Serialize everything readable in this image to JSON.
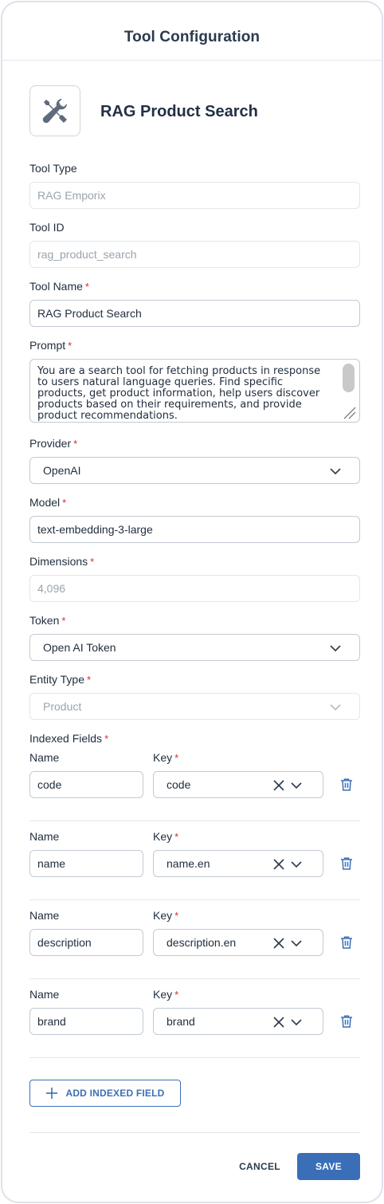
{
  "dialog": {
    "title": "Tool Configuration"
  },
  "tool": {
    "icon": "tools-icon",
    "display_name": "RAG Product Search"
  },
  "fields": {
    "tool_type": {
      "label": "Tool Type",
      "value": "RAG Emporix"
    },
    "tool_id": {
      "label": "Tool ID",
      "value": "rag_product_search"
    },
    "tool_name": {
      "label": "Tool Name",
      "required_mark": "*",
      "value": "RAG Product Search"
    },
    "prompt": {
      "label": "Prompt",
      "required_mark": "*",
      "lines": [
        "You are a search tool for fetching products in response",
        "to users natural language queries. Find specific",
        "products, get product information, help users discover",
        "products based on their requirements, and provide",
        "product recommendations."
      ]
    },
    "provider": {
      "label": "Provider",
      "required_mark": "*",
      "value": "OpenAI"
    },
    "model": {
      "label": "Model",
      "required_mark": "*",
      "value": "text-embedding-3-large"
    },
    "dimensions": {
      "label": "Dimensions",
      "required_mark": "*",
      "value": "4,096"
    },
    "token": {
      "label": "Token",
      "required_mark": "*",
      "value": "Open AI Token"
    },
    "entity_type": {
      "label": "Entity Type",
      "required_mark": "*",
      "value": "Product"
    }
  },
  "indexed_fields": {
    "label": "Indexed Fields",
    "required_mark": "*",
    "name_label": "Name",
    "key_label": "Key",
    "rows": [
      {
        "name": "code",
        "key": "code"
      },
      {
        "name": "name",
        "key": "name.en"
      },
      {
        "name": "description",
        "key": "description.en"
      },
      {
        "name": "brand",
        "key": "brand"
      }
    ]
  },
  "actions": {
    "add_indexed_field": "ADD INDEXED FIELD",
    "cancel": "CANCEL",
    "save": "SAVE"
  },
  "colors": {
    "accent": "#3a6fb8",
    "required": "#d32f2f",
    "icon_gray": "#5f6b7a",
    "border": "#c3cad4"
  }
}
